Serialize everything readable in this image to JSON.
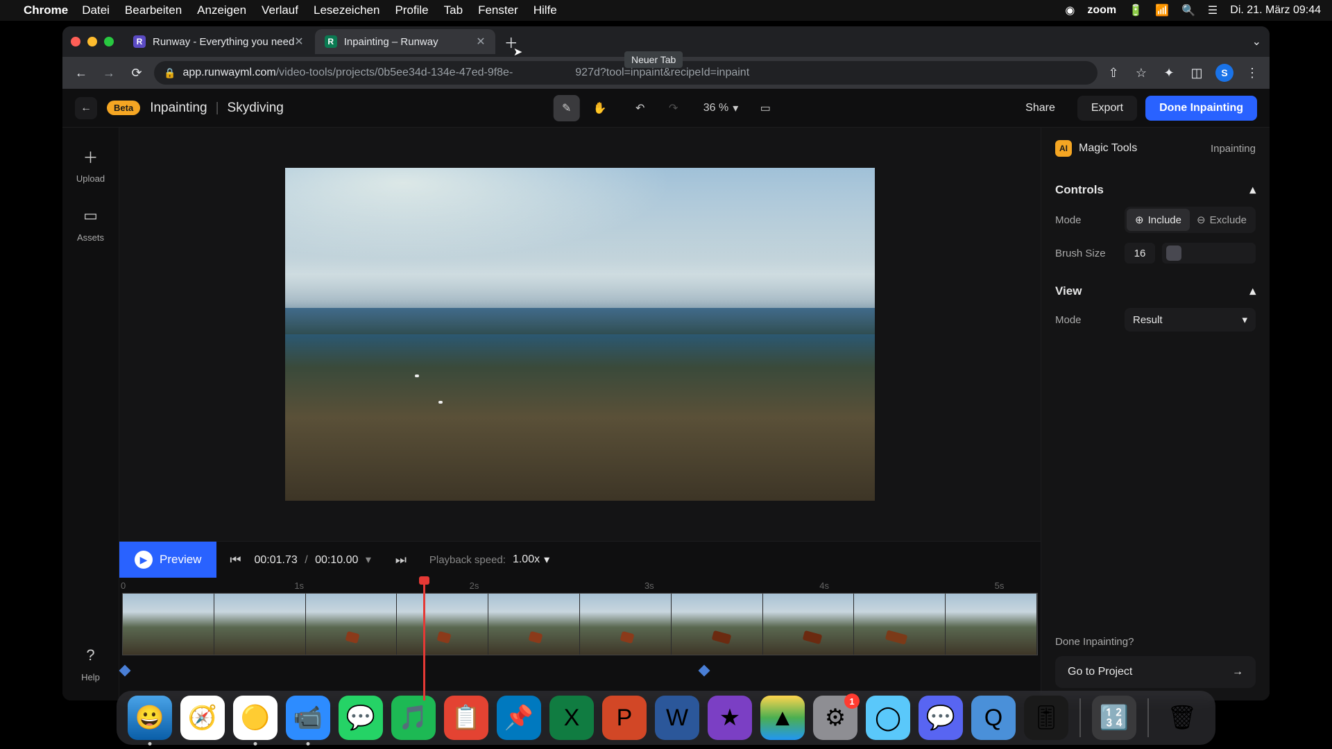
{
  "menubar": {
    "app": "Chrome",
    "items": [
      "Datei",
      "Bearbeiten",
      "Anzeigen",
      "Verlauf",
      "Lesezeichen",
      "Profile",
      "Tab",
      "Fenster",
      "Hilfe"
    ],
    "zoom": "zoom",
    "datetime": "Di. 21. März  09:44"
  },
  "tabs": [
    {
      "title": "Runway - Everything you need"
    },
    {
      "title": "Inpainting – Runway"
    }
  ],
  "tooltip": "Neuer Tab",
  "url": {
    "host": "app.runwayml.com",
    "path_a": "/video-tools/projects/0b5ee34d-134e-47ed-9f8e-",
    "path_b": "927d?tool=inpaint&recipeId=inpaint"
  },
  "header": {
    "beta": "Beta",
    "tool": "Inpainting",
    "project": "Skydiving",
    "zoom": "36 %",
    "share": "Share",
    "export": "Export",
    "done": "Done Inpainting"
  },
  "rail": {
    "upload": "Upload",
    "assets": "Assets",
    "help": "Help"
  },
  "transport": {
    "preview": "Preview",
    "current": "00:01.73",
    "sep": "/",
    "total": "00:10.00",
    "speed_label": "Playback speed:",
    "speed": "1.00x"
  },
  "ruler": [
    "0",
    "1s",
    "2s",
    "3s",
    "4s",
    "5s"
  ],
  "right": {
    "magic": "Magic Tools",
    "mode_name": "Inpainting",
    "controls": "Controls",
    "mode_label": "Mode",
    "include": "Include",
    "exclude": "Exclude",
    "brush_label": "Brush Size",
    "brush_value": "16",
    "view": "View",
    "view_mode_label": "Mode",
    "view_mode_value": "Result",
    "done_q": "Done Inpainting?",
    "goto": "Go to Project"
  },
  "avatar": "S",
  "dock_badge": "1"
}
